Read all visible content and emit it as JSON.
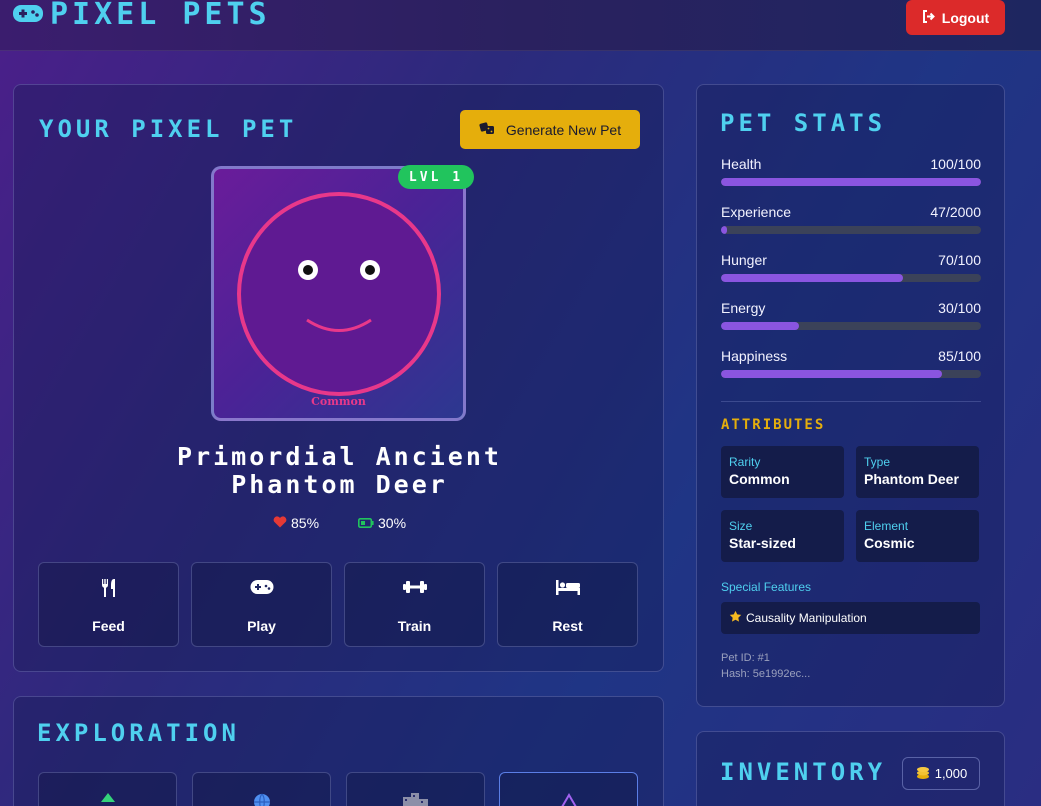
{
  "header": {
    "brand": "PIXEL PETS",
    "logout_label": "Logout"
  },
  "pet_panel": {
    "title": "YOUR PIXEL PET",
    "generate_label": "Generate New Pet",
    "level_badge": "LVL 1",
    "rarity_caption": "Common",
    "pet_name": "Primordial Ancient Phantom Deer",
    "health_percent": "85%",
    "energy_percent": "30%",
    "actions": [
      {
        "label": "Feed",
        "icon": "utensils-icon"
      },
      {
        "label": "Play",
        "icon": "gamepad-icon"
      },
      {
        "label": "Train",
        "icon": "dumbbell-icon"
      },
      {
        "label": "Rest",
        "icon": "bed-icon"
      }
    ]
  },
  "stats_panel": {
    "title": "PET STATS",
    "stats": [
      {
        "name": "Health",
        "value": "100/100",
        "fraction": 1.0
      },
      {
        "name": "Experience",
        "value": "47/2000",
        "fraction": 0.0235
      },
      {
        "name": "Hunger",
        "value": "70/100",
        "fraction": 0.7
      },
      {
        "name": "Energy",
        "value": "30/100",
        "fraction": 0.3
      },
      {
        "name": "Happiness",
        "value": "85/100",
        "fraction": 0.85
      }
    ],
    "attributes_title": "ATTRIBUTES",
    "attributes": [
      {
        "key": "Rarity",
        "value": "Common"
      },
      {
        "key": "Type",
        "value": "Phantom Deer"
      },
      {
        "key": "Size",
        "value": "Star-sized"
      },
      {
        "key": "Element",
        "value": "Cosmic"
      }
    ],
    "special_features_label": "Special Features",
    "special_feature": "Causality Manipulation",
    "pet_id": "Pet ID: #1",
    "hash": "Hash: 5e1992ec..."
  },
  "exploration": {
    "title": "EXPLORATION"
  },
  "inventory": {
    "title": "INVENTORY",
    "coins": "1,000"
  },
  "colors": {
    "accent_cyan": "#4fd0ef",
    "gold": "#e5ae0c",
    "danger": "#dc2a2a",
    "bar_fill": "#8a55e0",
    "level_green": "#21c45d",
    "pet_pink": "#e8388a"
  }
}
